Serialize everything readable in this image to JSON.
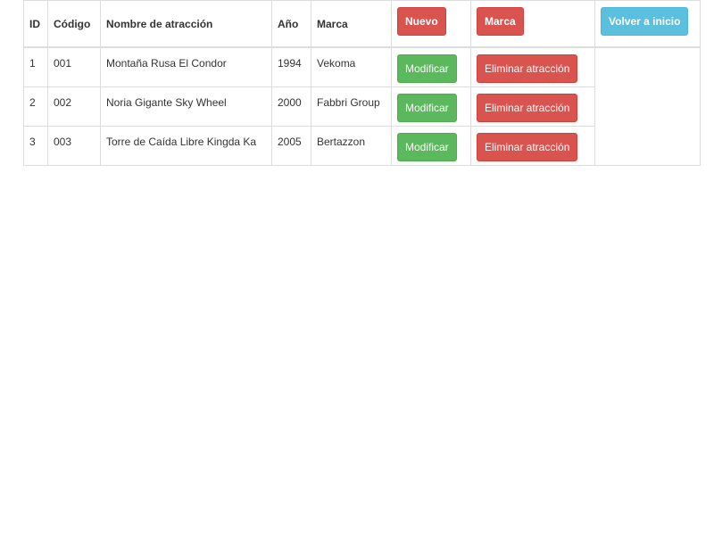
{
  "header": {
    "col_id": "ID",
    "col_codigo": "Código",
    "col_nombre": "Nombre de atracción",
    "col_anio": "Año",
    "col_marca": "Marca",
    "nuevo_label": "Nuevo",
    "marca_label": "Marca",
    "volver_label": "Volver a inicio"
  },
  "rows": [
    {
      "id": "1",
      "codigo": "001",
      "nombre": "Montaña Rusa El Condor",
      "anio": "1994",
      "marca": "Vekoma",
      "modificar": "Modificar",
      "eliminar": "Eliminar atracción"
    },
    {
      "id": "2",
      "codigo": "002",
      "nombre": "Noria Gigante Sky Wheel",
      "anio": "2000",
      "marca": "Fabbri Group",
      "modificar": "Modificar",
      "eliminar": "Eliminar atracción"
    },
    {
      "id": "3",
      "codigo": "003",
      "nombre": "Torre de Caída Libre Kingda Ka",
      "anio": "2005",
      "marca": "Bertazzon",
      "modificar": "Modificar",
      "eliminar": "Eliminar atracción"
    }
  ],
  "colors": {
    "danger": "#d9534f",
    "success": "#5cb85c",
    "info": "#5bc0de"
  }
}
